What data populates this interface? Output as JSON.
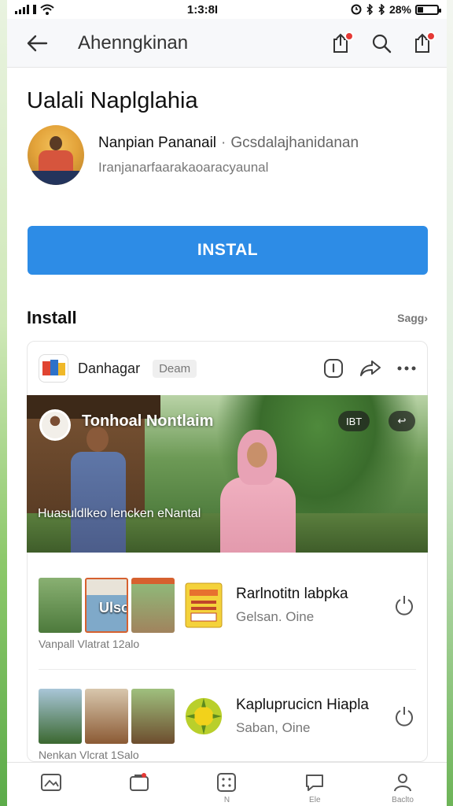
{
  "status_bar": {
    "time": "1:3:8I",
    "battery": "28%",
    "battery_level": 0.28
  },
  "app_bar": {
    "title": "Ahenngkinan"
  },
  "app": {
    "title": "Ualali Naplglahia",
    "developer": "Nanpian Pananail",
    "separator": "·",
    "category": "Gcsdalajhanidanan",
    "description": "Iranjanarfaarakaoaracyaunal",
    "install_label": "INSTAL"
  },
  "section": {
    "title": "Install",
    "link": "Sagg›"
  },
  "post": {
    "name": "Danhagar",
    "badge": "Deam",
    "hero_title": "Tonhoal Nontlaim",
    "chip_left": "IBT",
    "chip_right": "↩",
    "hero_caption": "Huasuldlkeo lencken eNantal"
  },
  "list": [
    {
      "title": "Rarlnotitn labpka",
      "subtitle": "Gelsan. Oine",
      "thumb_label": "Ulso",
      "caption": "Vanpall  Vlatrat  12alo"
    },
    {
      "title": "Kapluprucicn Hiapla",
      "subtitle": "Saban, Oine",
      "thumb_label": "",
      "caption": "Nenkan  Vlcrat  1Salo"
    }
  ],
  "bottom_nav": [
    {
      "label": "",
      "icon": "image-icon"
    },
    {
      "label": "",
      "icon": "store-icon"
    },
    {
      "label": "N",
      "icon": "apps-icon"
    },
    {
      "label": "Ele",
      "icon": "chat-icon"
    },
    {
      "label": "Baclto",
      "icon": "profile-icon"
    }
  ],
  "colors": {
    "accent": "#2d8ce6",
    "badge_dot": "#e53935"
  }
}
